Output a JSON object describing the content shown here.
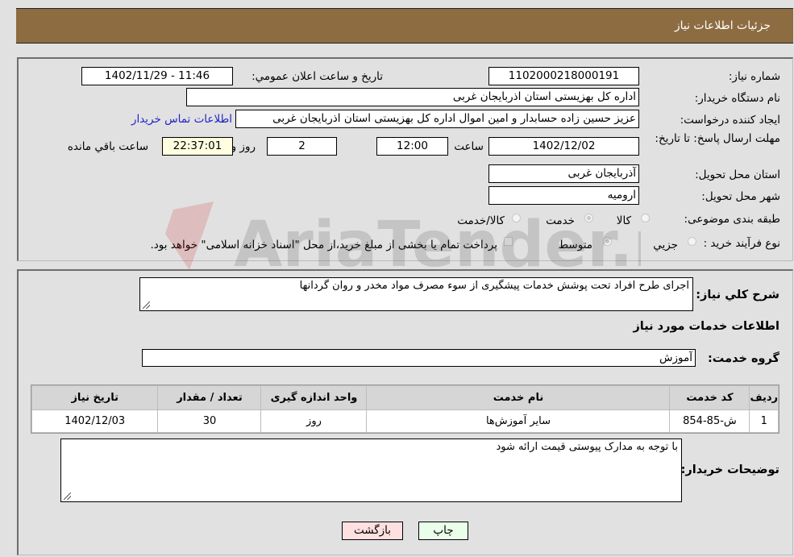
{
  "header": {
    "title": "جزئیات اطلاعات نیاز"
  },
  "form": {
    "need_number_label": "شماره نیاز:",
    "need_number": "1102000218000191",
    "announce_label": "تاریخ و ساعت اعلان عمومي:",
    "announce_value": "1402/11/29 - 11:46",
    "buyer_org_label": "نام دستگاه خریدار:",
    "buyer_org": "اداره کل بهزیستی استان اذربایجان غربی",
    "creator_label": "ایجاد کننده درخواست:",
    "creator": "عزیز حسین زاده حسابدار و امین اموال اداره کل بهزیستی استان اذربایجان غربی",
    "contact_link": "اطلاعات تماس خریدار",
    "deadline_label": "مهلت ارسال پاسخ: تا تاریخ:",
    "deadline_date": "1402/12/02",
    "time_label": "ساعت",
    "deadline_time": "12:00",
    "days_value": "2",
    "days_label": "روز و",
    "remaining_time": "22:37:01",
    "remaining_label": "ساعت باقي مانده",
    "province_label": "استان محل تحویل:",
    "province": "آذربایجان غربی",
    "city_label": "شهر محل تحویل:",
    "city": "ارومیه",
    "category_label": "طبقه بندی موضوعی:",
    "category_options": [
      {
        "label": "کالا",
        "checked": false
      },
      {
        "label": "خدمت",
        "checked": true
      },
      {
        "label": "کالا/خدمت",
        "checked": false
      }
    ],
    "process_label": "نوع فرآیند خرید :",
    "process_options": [
      {
        "label": "جزيي",
        "checked": false
      },
      {
        "label": "متوسط",
        "checked": true
      }
    ],
    "treasury_checkbox_label": "پرداخت تمام یا بخشی از مبلغ خرید،از محل \"اسناد خزانه اسلامی\" خواهد بود."
  },
  "details": {
    "summary_label": "شرح كلي نياز:",
    "summary": "اجرای طرح افراد تحت پوشش خدمات پیشگیری از سوء مصرف مواد مخدر و روان گردانها",
    "services_heading": "اطلاعات خدمات مورد نیاز",
    "service_group_label": "گروه خدمت:",
    "service_group": "آموزش",
    "table": {
      "headers": [
        "ردیف",
        "کد خدمت",
        "نام خدمت",
        "واحد اندازه گیری",
        "تعداد / مقدار",
        "تاریخ نیاز"
      ],
      "rows": [
        [
          "1",
          "ش-85-854",
          "سایر آموزش‌ها",
          "روز",
          "30",
          "1402/12/03"
        ]
      ]
    },
    "buyer_notes_label": "توضیحات خریدار:",
    "buyer_notes": "با توجه به مدارک پیوستی قیمت ارائه شود"
  },
  "buttons": {
    "print": "چاپ",
    "back": "بازگشت"
  },
  "watermark": "AriaTender.neT",
  "colors": {
    "header_bg": "#8d6c42",
    "print_bg": "#eaffea",
    "back_bg": "#ffe0e0",
    "link": "#2222cc"
  }
}
